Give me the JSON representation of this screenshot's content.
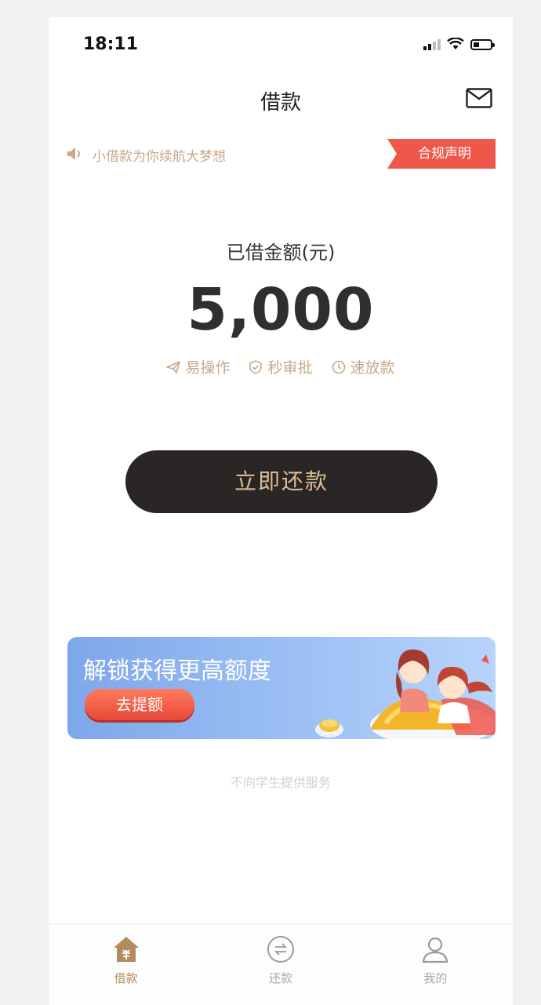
{
  "status_bar": {
    "time": "18:11"
  },
  "nav": {
    "title": "借款"
  },
  "notice": {
    "text": "小借款为你续航大梦想",
    "compliance_label": "合规声明"
  },
  "loan": {
    "amount_label": "已借金额(元)",
    "amount": "5,000",
    "features": [
      "易操作",
      "秒审批",
      "速放款"
    ]
  },
  "actions": {
    "repay_label": "立即还款"
  },
  "banner": {
    "title": "解锁获得更高额度",
    "button_label": "去提额"
  },
  "footer": {
    "disclaimer": "不向学生提供服务"
  },
  "tabs": [
    {
      "label": "借款",
      "icon": "home-icon",
      "active": true
    },
    {
      "label": "还款",
      "icon": "repay-icon",
      "active": false
    },
    {
      "label": "我的",
      "icon": "profile-icon",
      "active": false
    }
  ],
  "colors": {
    "accent_gold": "#b38b5d",
    "feature_gold": "#c8a98a",
    "tag_red": "#f0574b",
    "button_dark": "#2b2626",
    "banner_blue": "#7ea7ea"
  }
}
